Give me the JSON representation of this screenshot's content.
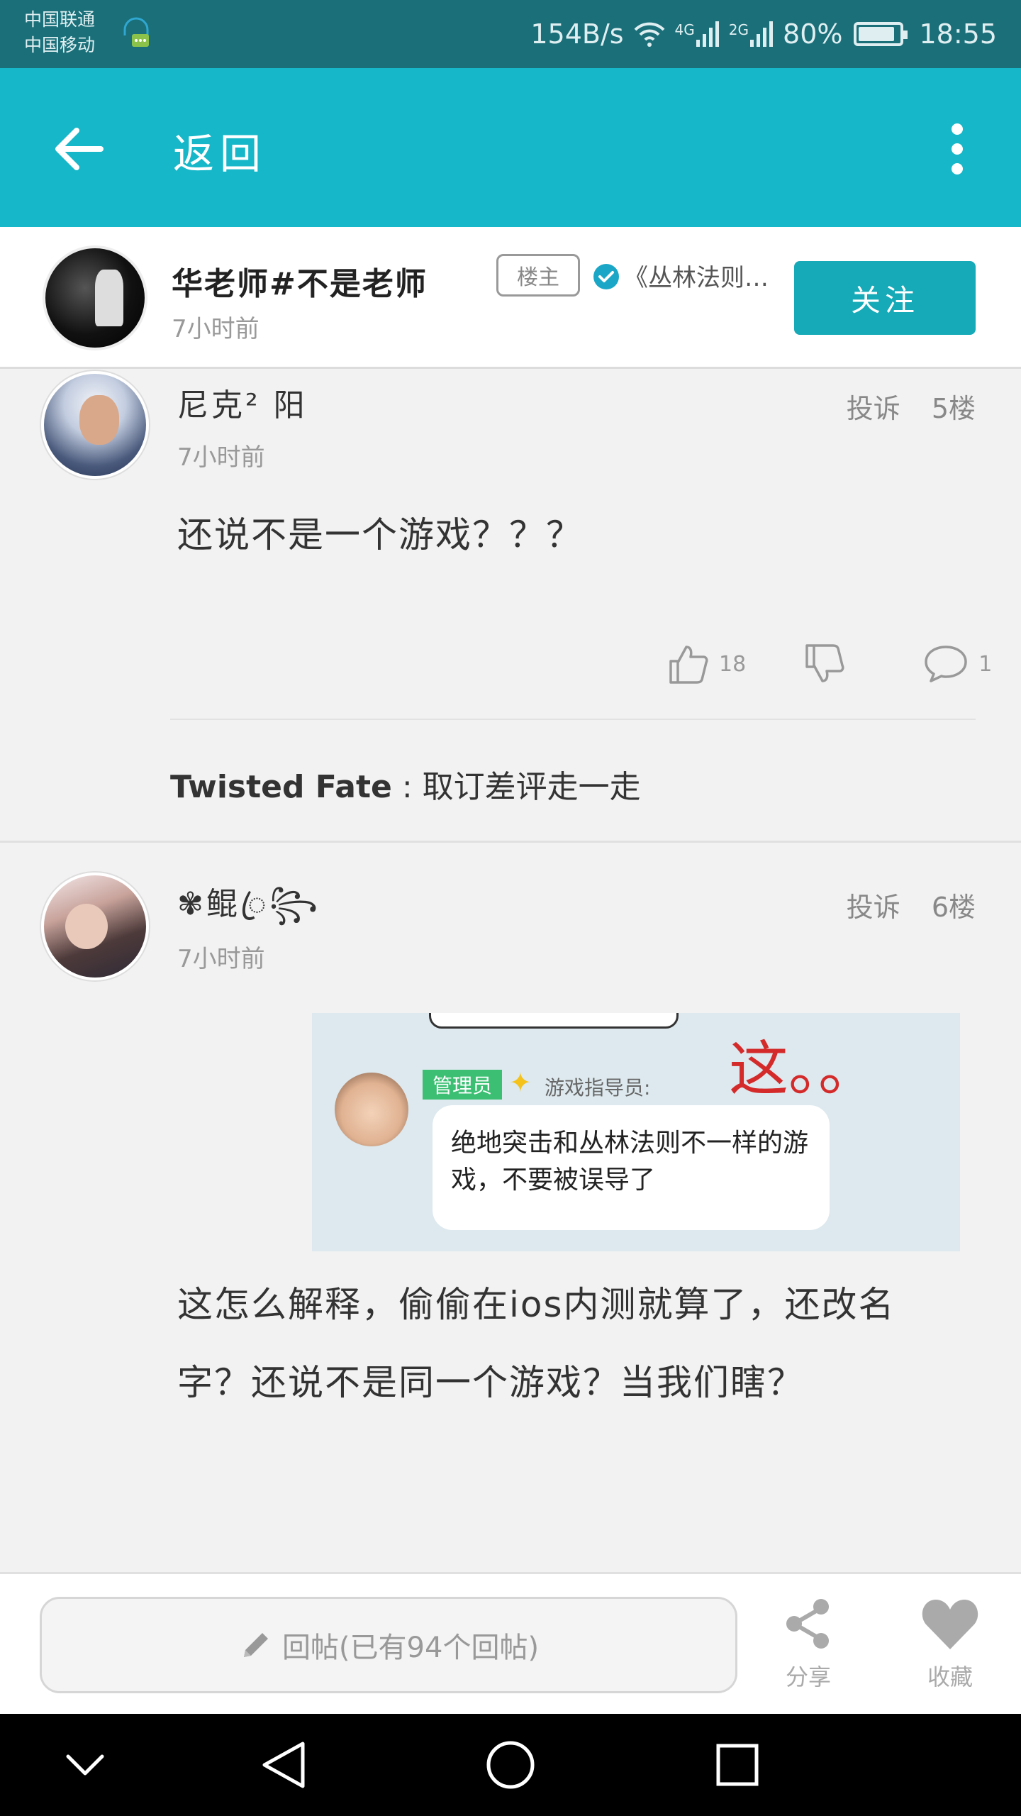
{
  "status_bar": {
    "carrier_1": "中国联通",
    "carrier_2": "中国移动",
    "net_speed": "154B/s",
    "net_4g": "4G",
    "net_2g": "2G",
    "battery": "80%",
    "time": "18:55"
  },
  "app_bar": {
    "title": "返回",
    "back_icon": "arrow-left-icon",
    "more_icon": "more-vertical-icon"
  },
  "op": {
    "name": "华老师#不是老师",
    "tag": "楼主",
    "game": "《丛林法则…",
    "time": "7小时前",
    "follow_label": "关注"
  },
  "replies": [
    {
      "username": "尼克² 阳",
      "time": "7小时前",
      "report_label": "投诉",
      "floor": "5楼",
      "content": "还说不是一个游戏？？？",
      "likes": "18",
      "comments": "1",
      "sub_reply": {
        "author": "Twisted Fate",
        "sep": " : ",
        "text": "取订差评走一走"
      }
    },
    {
      "username": "✾鲲ꦿ꧂",
      "time": "7小时前",
      "report_label": "投诉",
      "floor": "6楼",
      "content": "这怎么解释，偷偷在ios内测就算了，还改名字？还说不是同一个游戏？当我们瞎？",
      "image": {
        "badge": "管理员",
        "role": "游戏指导员:",
        "message": "绝地突击和丛林法则不一样的游戏，不要被误导了",
        "annotation": "这。。"
      }
    }
  ],
  "bottom_bar": {
    "reply_placeholder": "回帖(已有94个回帖)",
    "share_label": "分享",
    "favorite_label": "收藏"
  },
  "colors": {
    "status_bar": "#1a6f79",
    "app_bar": "#16b7c8",
    "follow_button": "#16a9b7"
  }
}
